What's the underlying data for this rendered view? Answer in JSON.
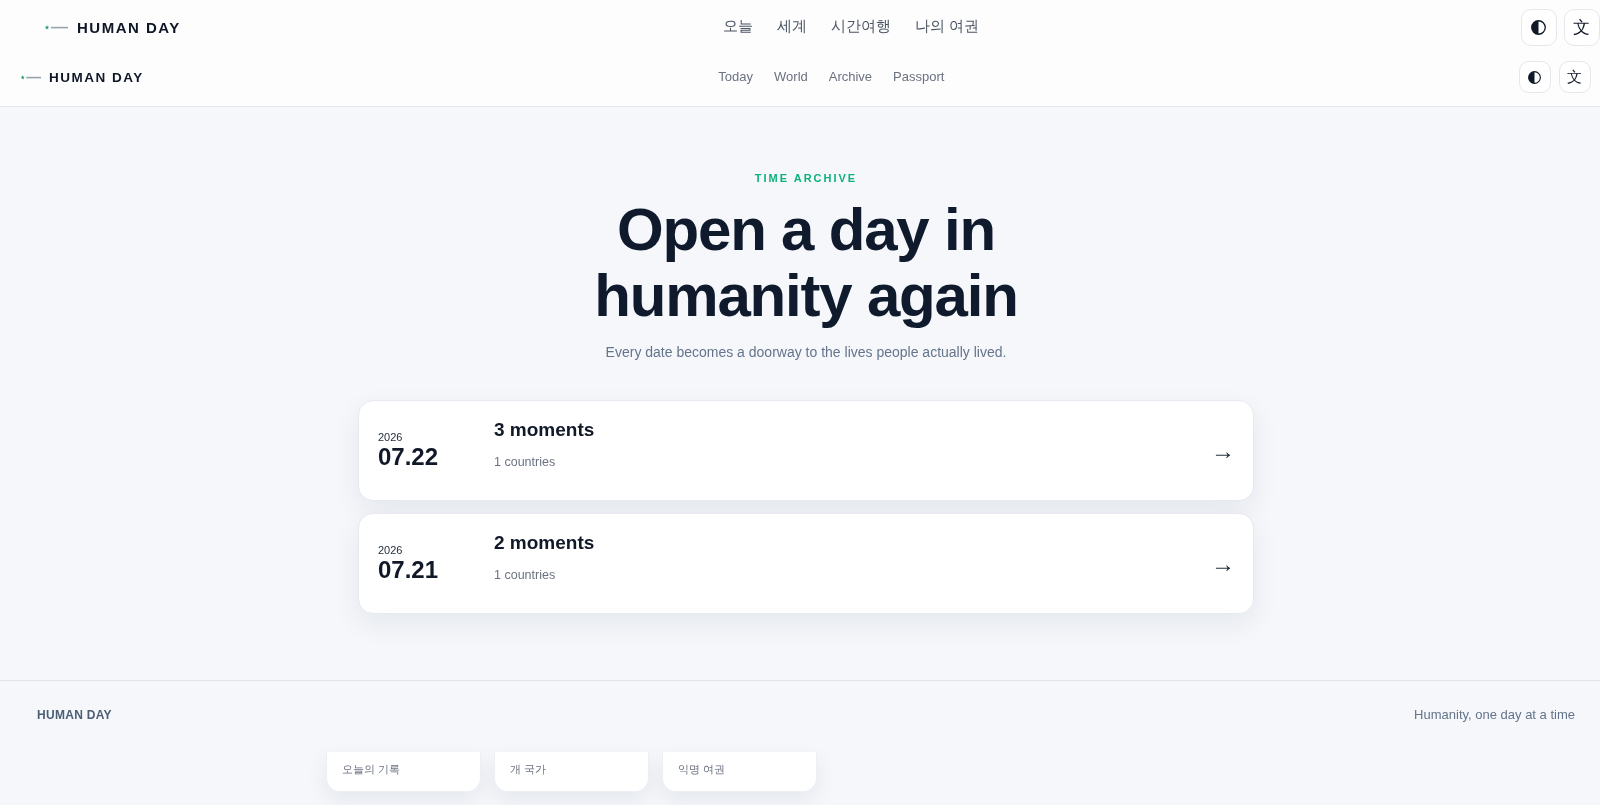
{
  "headers": [
    {
      "kind": "large",
      "brand": "HUMAN DAY",
      "nav": [
        {
          "label": "오늘",
          "selected": false
        },
        {
          "label": "세계",
          "selected": false
        },
        {
          "label": "시간여행",
          "selected": false
        },
        {
          "label": "나의 여권",
          "selected": false
        }
      ],
      "buttons": [
        {
          "kind": "contrast"
        },
        {
          "kind": "language",
          "label": "文"
        }
      ]
    },
    {
      "kind": "compact",
      "brand": "HUMAN DAY",
      "nav": [
        {
          "label": "Today",
          "selected": false
        },
        {
          "label": "World",
          "selected": false
        },
        {
          "label": "Archive",
          "selected": false
        },
        {
          "label": "Passport",
          "selected": false
        }
      ],
      "buttons": [
        {
          "kind": "contrast"
        },
        {
          "kind": "language",
          "label": "文"
        }
      ]
    }
  ],
  "hero": {
    "eyebrow": "TIME ARCHIVE",
    "title": "Open a day in humanity again",
    "subtitle": "Every date becomes a doorway to the lives people actually lived."
  },
  "archive": [
    {
      "year": "2026",
      "date": "07.22",
      "moments": "3 moments",
      "countries": "1 countries",
      "arrow": "→"
    },
    {
      "year": "2026",
      "date": "07.21",
      "moments": "2 moments",
      "countries": "1 countries",
      "arrow": "→"
    }
  ],
  "footer": {
    "brand": "HUMAN DAY",
    "tagline": "Humanity, one day at a time"
  },
  "stat_cards": [
    {
      "label": "오늘의 기록"
    },
    {
      "label": "개 국가"
    },
    {
      "label": "익명 여권"
    }
  ]
}
